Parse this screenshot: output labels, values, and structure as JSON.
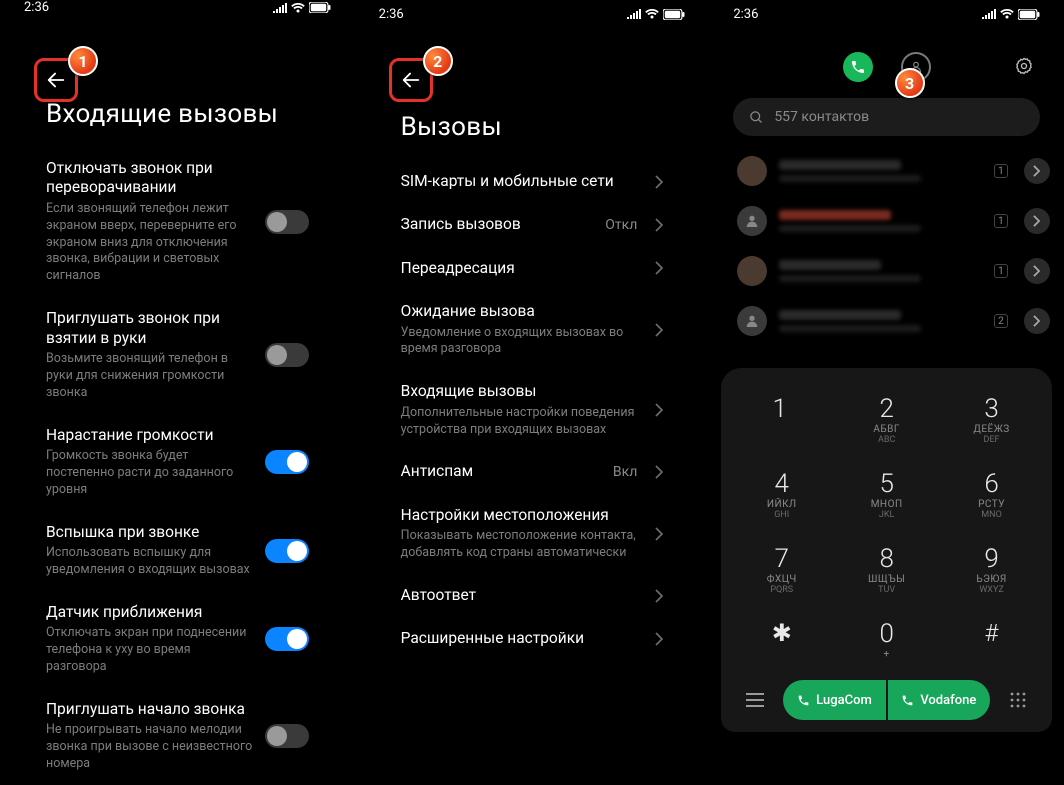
{
  "status_time": "2:36",
  "badges": {
    "b1": "1",
    "b2": "2",
    "b3": "3"
  },
  "screen1": {
    "title": "Входящие вызовы",
    "items": [
      {
        "title": "Отключать звонок при переворачивании",
        "sub": "Если звонящий телефон лежит экраном вверх, переверните его экраном вниз для отключения звонка, вибрации и световых сигналов",
        "on": false
      },
      {
        "title": "Приглушать звонок при взятии в руки",
        "sub": "Возьмите звонящий телефон в руки для снижения громкости звонка",
        "on": false
      },
      {
        "title": "Нарастание громкости",
        "sub": "Громкость звонка будет постепенно расти до заданного уровня",
        "on": true
      },
      {
        "title": "Вспышка при звонке",
        "sub": "Использовать вспышку для уведомления о входящих вызовах",
        "on": true
      },
      {
        "title": "Датчик приближения",
        "sub": "Отключать экран при поднесении телефона к уху во время разговора",
        "on": true
      },
      {
        "title": "Приглушать начало звонка",
        "sub": "Не проигрывать начало мелодии звонка при вызове с неизвестного номера",
        "on": false
      }
    ]
  },
  "screen2": {
    "title": "Вызовы",
    "items": [
      {
        "title": "SIM-карты и мобильные сети",
        "sub": "",
        "value": "",
        "chevron": true
      },
      {
        "title": "Запись вызовов",
        "sub": "",
        "value": "Откл",
        "chevron": true
      },
      {
        "title": "Переадресация",
        "sub": "",
        "value": "",
        "chevron": true
      },
      {
        "title": "Ожидание вызова",
        "sub": "Уведомление о входящих вызовах во время разговора",
        "value": "",
        "chevron": true
      },
      {
        "title": "Входящие вызовы",
        "sub": "Дополнительные настройки поведения устройства при входящих вызовах",
        "value": "",
        "chevron": true
      },
      {
        "title": "Антиспам",
        "sub": "",
        "value": "Вкл",
        "chevron": true
      },
      {
        "title": "Настройки местоположения",
        "sub": "Показывать местоположение контакта, добавлять код страны автоматически",
        "value": "",
        "chevron": true
      },
      {
        "title": "Автоответ",
        "sub": "",
        "value": "",
        "chevron": true
      },
      {
        "title": "Расширенные настройки",
        "sub": "",
        "value": "",
        "chevron": true
      }
    ]
  },
  "screen3": {
    "search_placeholder": "557 контактов",
    "contact_badges": [
      "1",
      "1",
      "1",
      "2"
    ],
    "keys": [
      [
        {
          "n": "1",
          "a": "",
          "b": ""
        },
        {
          "n": "2",
          "a": "АБВГ",
          "b": "ABC"
        },
        {
          "n": "3",
          "a": "ДЕЁЖЗ",
          "b": "DEF"
        }
      ],
      [
        {
          "n": "4",
          "a": "ИЙКЛ",
          "b": "GHI"
        },
        {
          "n": "5",
          "a": "МНОП",
          "b": "JKL"
        },
        {
          "n": "6",
          "a": "РСТУ",
          "b": "MNO"
        }
      ],
      [
        {
          "n": "7",
          "a": "ФХЦЧ",
          "b": "PQRS"
        },
        {
          "n": "8",
          "a": "ШЩЪЫ",
          "b": "TUV"
        },
        {
          "n": "9",
          "a": "ЬЭЮЯ",
          "b": "WXYZ"
        }
      ],
      [
        {
          "n": "✱",
          "a": "",
          "b": ""
        },
        {
          "n": "0",
          "a": "+",
          "b": ""
        },
        {
          "n": "#",
          "a": "",
          "b": ""
        }
      ]
    ],
    "call1": "LugaCom",
    "call2": "Vodafone"
  }
}
